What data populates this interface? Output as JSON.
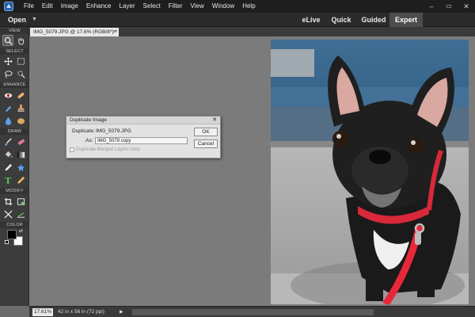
{
  "menubar": {
    "items": [
      "File",
      "Edit",
      "Image",
      "Enhance",
      "Layer",
      "Select",
      "Filter",
      "View",
      "Window",
      "Help"
    ]
  },
  "modebar": {
    "open_label": "Open",
    "tabs": [
      "eLive",
      "Quick",
      "Guided",
      "Expert"
    ],
    "active_tab": "Expert"
  },
  "document": {
    "tab_title": "IMG_5079.JPG @ 17.6% (RGB/8*) *"
  },
  "toolbox": {
    "sections": [
      "VIEW",
      "SELECT",
      "ENHANCE",
      "DRAW",
      "MODIFY",
      "COLOR"
    ]
  },
  "dialog": {
    "title": "Duplicate Image",
    "duplicate_label": "Duplicate:",
    "duplicate_value": "IMG_5079.JPG",
    "as_label": "As:",
    "as_value": "IMG_5079 copy",
    "ok_label": "OK",
    "cancel_label": "Cancel",
    "checkbox_label": "Duplicate Merged Layers Only"
  },
  "status": {
    "zoom": "17.61%",
    "doc_info": "42 in x 56 in (72 ppi)"
  },
  "colors": {
    "foreground": "#000000",
    "background": "#ffffff"
  }
}
